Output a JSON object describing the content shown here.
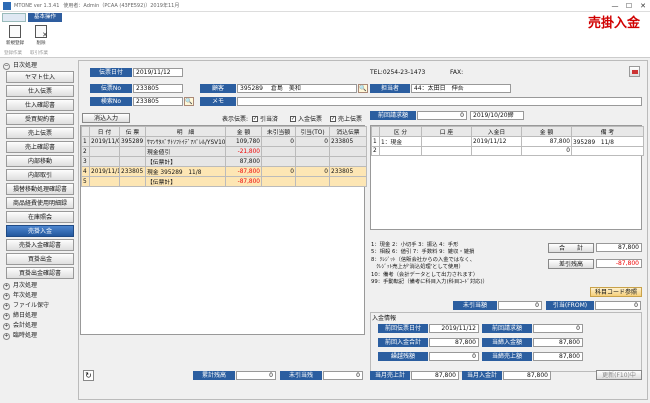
{
  "window": {
    "title": "MTONE ver 1.3.41",
    "user": "使用者：Admin（PCAA (43FE592)）2019年11月",
    "btn_min": "—",
    "btn_max": "☐",
    "btn_close": "✕"
  },
  "ribbon": {
    "tab": "基本操作",
    "new_label": "新規登録",
    "delete_label": "削除",
    "group1": "登録作業",
    "group2": "取引作業"
  },
  "page_title": "売掛入金",
  "sidebar": {
    "group_daily": "日次処理",
    "items": [
      "ヤマト仕入",
      "仕入伝票",
      "仕入確認書",
      "受買契約書",
      "売上伝票",
      "売上確認書",
      "内部移動",
      "内部取引",
      "損替移動処理確認書",
      "商品経費使用明細録",
      "在庫照会",
      "売掛入金",
      "売掛入金確認書",
      "買掛出金",
      "買掛出金確認書"
    ],
    "groups": [
      "月次処理",
      "年次処理",
      "ファイル保守",
      "締日処理",
      "会計処理",
      "臨時処理"
    ]
  },
  "form": {
    "date_label": "伝票日付",
    "date_value": "2019/11/12",
    "slip_label": "伝票No",
    "slip_value": "233805",
    "search_label": "検索No",
    "search_value": "233805",
    "customer_label": "顧客",
    "customer_code": "395289",
    "customer_name": "倉島　美和",
    "staff_label": "担当者",
    "staff_value": "44：太田日　伸吾",
    "memo_label": "メモ",
    "tel": "TEL:0254-23-1473",
    "fax": "FAX:",
    "deposit_btn": "消込入力",
    "display_label": "表示伝票:",
    "chk1": "引当済",
    "chk2": "入金伝票",
    "chk3": "売上伝票",
    "prev_label": "前回請求額",
    "prev_value": "0",
    "prev_date": "2019/10/20締"
  },
  "left_table": {
    "headers": [
      "日 付",
      "伝 票",
      "明　細",
      "金 額",
      "未引当額",
      "引当(TO)",
      "消込伝票"
    ],
    "rows": [
      {
        "cells": [
          "2019/11/09",
          "395289",
          "ｻﾏﾝｻﾀﾊﾞｻﾄｿﾌﾄｲﾃﾞｱﾊﾟﾚﾙ/YSV10",
          "109,780",
          "0",
          "0",
          "233805"
        ],
        "style": "g"
      },
      {
        "cells": [
          "",
          "",
          "現金値引",
          "-21,800",
          "",
          "",
          ""
        ],
        "style": "g"
      },
      {
        "cells": [
          "",
          "",
          "【伝票計】",
          "87,800",
          "",
          "",
          ""
        ],
        "style": "g"
      },
      {
        "cells": [
          "2019/11/12",
          "233805",
          "現金 395289　11/8",
          "-87,800",
          "0",
          "0",
          "233805"
        ],
        "style": "y"
      },
      {
        "cells": [
          "",
          "",
          "【伝票計】",
          "-87,800",
          "",
          "",
          ""
        ],
        "style": "y"
      }
    ]
  },
  "row_numbers": [
    "1",
    "2",
    "3",
    "4",
    "5"
  ],
  "right_table": {
    "headers": [
      "区 分",
      "口 座",
      "入金日",
      "金 額",
      "備 考"
    ],
    "rows": [
      {
        "no": "1",
        "cells": [
          "1：現金",
          "",
          "2019/11/12",
          "87,800",
          "395289　11/8"
        ]
      },
      {
        "no": "2",
        "cells": [
          "",
          "",
          "",
          "0",
          ""
        ]
      }
    ]
  },
  "notes": [
    "1：現金 2：小切手 3：振込 4：手形",
    "5：相殺 6：値引 7：手数料 9：雑収・雑損",
    "8：ｸﾚｼﾞｯﾄ（信販会社からの入金ではなく、",
    "　ｸﾚｼﾞｯﾄ売上が'消込処理'として使用）",
    "10：備考（会計データとして出力されます）",
    "99：手動転記（備考に科目入力(科目ｺｰﾄﾞ対応)）"
  ],
  "totals": {
    "sum_label": "合　　計",
    "sum_value": "87,800",
    "diff_label": "差引残高",
    "diff_value": "-87,800",
    "code_btn": "科目コード参照"
  },
  "alloc": {
    "unalloc_label": "未引当額",
    "unalloc_value": "0",
    "from_label": "引当(FROM)",
    "from_value": "0"
  },
  "deposit_info": {
    "title": "入金情報",
    "prev_date_label": "前回伝票日付",
    "prev_date_value": "2019/11/12",
    "prev_bill_label": "前回請求額",
    "prev_bill_value": "0",
    "prev_total_label": "前回入金合計",
    "prev_total_value": "87,800",
    "cur_total_label": "当締入金額",
    "cur_total_value": "87,800",
    "carry_label": "繰越残額",
    "carry_value": "0",
    "cur_sales_label": "当締売上額",
    "cur_sales_value": "87,800"
  },
  "footer": {
    "balance_label": "累計残高",
    "balance_value": "0",
    "unalloc_label": "未引当残",
    "unalloc_value": "0",
    "month_sales_label": "当月売上計",
    "month_sales_value": "87,800",
    "month_deposit_label": "当月入金計",
    "month_deposit_value": "87,800",
    "update_btn": "更新(F10)中"
  }
}
